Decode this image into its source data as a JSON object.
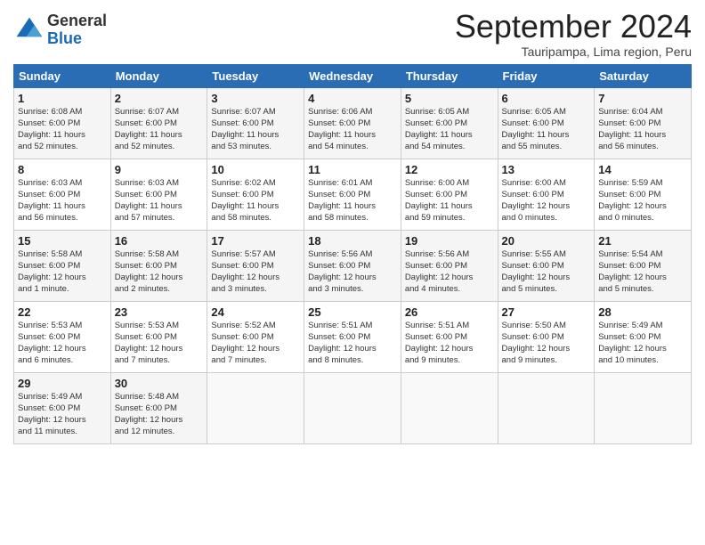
{
  "header": {
    "logo_general": "General",
    "logo_blue": "Blue",
    "month_title": "September 2024",
    "location": "Tauripampa, Lima region, Peru"
  },
  "calendar": {
    "days_of_week": [
      "Sunday",
      "Monday",
      "Tuesday",
      "Wednesday",
      "Thursday",
      "Friday",
      "Saturday"
    ],
    "weeks": [
      [
        {
          "day": "",
          "info": ""
        },
        {
          "day": "2",
          "info": "Sunrise: 6:07 AM\nSunset: 6:00 PM\nDaylight: 11 hours\nand 52 minutes."
        },
        {
          "day": "3",
          "info": "Sunrise: 6:07 AM\nSunset: 6:00 PM\nDaylight: 11 hours\nand 53 minutes."
        },
        {
          "day": "4",
          "info": "Sunrise: 6:06 AM\nSunset: 6:00 PM\nDaylight: 11 hours\nand 54 minutes."
        },
        {
          "day": "5",
          "info": "Sunrise: 6:05 AM\nSunset: 6:00 PM\nDaylight: 11 hours\nand 54 minutes."
        },
        {
          "day": "6",
          "info": "Sunrise: 6:05 AM\nSunset: 6:00 PM\nDaylight: 11 hours\nand 55 minutes."
        },
        {
          "day": "7",
          "info": "Sunrise: 6:04 AM\nSunset: 6:00 PM\nDaylight: 11 hours\nand 56 minutes."
        }
      ],
      [
        {
          "day": "1",
          "info": "Sunrise: 6:08 AM\nSunset: 6:00 PM\nDaylight: 11 hours\nand 52 minutes."
        },
        {
          "day": "9",
          "info": "Sunrise: 6:03 AM\nSunset: 6:00 PM\nDaylight: 11 hours\nand 57 minutes."
        },
        {
          "day": "10",
          "info": "Sunrise: 6:02 AM\nSunset: 6:00 PM\nDaylight: 11 hours\nand 58 minutes."
        },
        {
          "day": "11",
          "info": "Sunrise: 6:01 AM\nSunset: 6:00 PM\nDaylight: 11 hours\nand 58 minutes."
        },
        {
          "day": "12",
          "info": "Sunrise: 6:00 AM\nSunset: 6:00 PM\nDaylight: 11 hours\nand 59 minutes."
        },
        {
          "day": "13",
          "info": "Sunrise: 6:00 AM\nSunset: 6:00 PM\nDaylight: 12 hours\nand 0 minutes."
        },
        {
          "day": "14",
          "info": "Sunrise: 5:59 AM\nSunset: 6:00 PM\nDaylight: 12 hours\nand 0 minutes."
        }
      ],
      [
        {
          "day": "8",
          "info": "Sunrise: 6:03 AM\nSunset: 6:00 PM\nDaylight: 11 hours\nand 56 minutes."
        },
        {
          "day": "16",
          "info": "Sunrise: 5:58 AM\nSunset: 6:00 PM\nDaylight: 12 hours\nand 2 minutes."
        },
        {
          "day": "17",
          "info": "Sunrise: 5:57 AM\nSunset: 6:00 PM\nDaylight: 12 hours\nand 3 minutes."
        },
        {
          "day": "18",
          "info": "Sunrise: 5:56 AM\nSunset: 6:00 PM\nDaylight: 12 hours\nand 3 minutes."
        },
        {
          "day": "19",
          "info": "Sunrise: 5:56 AM\nSunset: 6:00 PM\nDaylight: 12 hours\nand 4 minutes."
        },
        {
          "day": "20",
          "info": "Sunrise: 5:55 AM\nSunset: 6:00 PM\nDaylight: 12 hours\nand 5 minutes."
        },
        {
          "day": "21",
          "info": "Sunrise: 5:54 AM\nSunset: 6:00 PM\nDaylight: 12 hours\nand 5 minutes."
        }
      ],
      [
        {
          "day": "15",
          "info": "Sunrise: 5:58 AM\nSunset: 6:00 PM\nDaylight: 12 hours\nand 1 minute."
        },
        {
          "day": "23",
          "info": "Sunrise: 5:53 AM\nSunset: 6:00 PM\nDaylight: 12 hours\nand 7 minutes."
        },
        {
          "day": "24",
          "info": "Sunrise: 5:52 AM\nSunset: 6:00 PM\nDaylight: 12 hours\nand 7 minutes."
        },
        {
          "day": "25",
          "info": "Sunrise: 5:51 AM\nSunset: 6:00 PM\nDaylight: 12 hours\nand 8 minutes."
        },
        {
          "day": "26",
          "info": "Sunrise: 5:51 AM\nSunset: 6:00 PM\nDaylight: 12 hours\nand 9 minutes."
        },
        {
          "day": "27",
          "info": "Sunrise: 5:50 AM\nSunset: 6:00 PM\nDaylight: 12 hours\nand 9 minutes."
        },
        {
          "day": "28",
          "info": "Sunrise: 5:49 AM\nSunset: 6:00 PM\nDaylight: 12 hours\nand 10 minutes."
        }
      ],
      [
        {
          "day": "22",
          "info": "Sunrise: 5:53 AM\nSunset: 6:00 PM\nDaylight: 12 hours\nand 6 minutes."
        },
        {
          "day": "30",
          "info": "Sunrise: 5:48 AM\nSunset: 6:00 PM\nDaylight: 12 hours\nand 12 minutes."
        },
        {
          "day": "",
          "info": ""
        },
        {
          "day": "",
          "info": ""
        },
        {
          "day": "",
          "info": ""
        },
        {
          "day": "",
          "info": ""
        },
        {
          "day": "",
          "info": ""
        }
      ],
      [
        {
          "day": "29",
          "info": "Sunrise: 5:49 AM\nSunset: 6:00 PM\nDaylight: 12 hours\nand 11 minutes."
        },
        {
          "day": "",
          "info": ""
        },
        {
          "day": "",
          "info": ""
        },
        {
          "day": "",
          "info": ""
        },
        {
          "day": "",
          "info": ""
        },
        {
          "day": "",
          "info": ""
        },
        {
          "day": "",
          "info": ""
        }
      ]
    ]
  }
}
